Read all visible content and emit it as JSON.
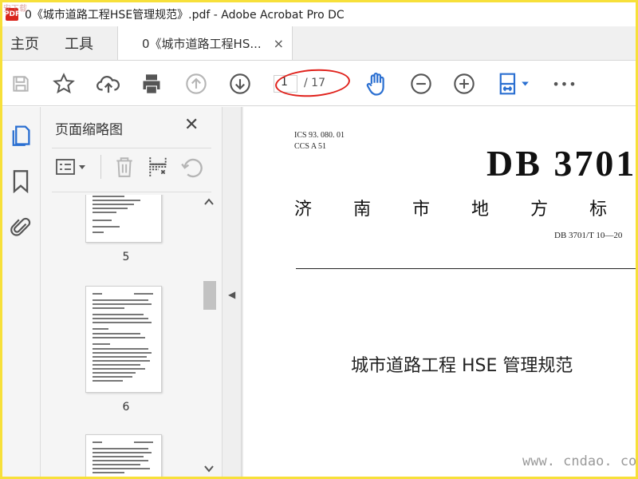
{
  "window": {
    "title": "0《城市道路工程HSE管理规范》.pdf - Adobe Acrobat Pro DC",
    "watermark_corner": "安下载",
    "app_icon_text": "PDF"
  },
  "tabs": {
    "home": "主页",
    "tools": "工具",
    "document": "0《城市道路工程HS...",
    "close": "×"
  },
  "toolbar": {
    "page_current": "1",
    "page_total": "/ 17",
    "more": "•••"
  },
  "panel": {
    "title": "页面缩略图",
    "close": "✕",
    "thumbnails": [
      {
        "label": "5"
      },
      {
        "label": "6"
      }
    ]
  },
  "document": {
    "ics": "ICS   93. 080. 01",
    "ccs": "CCS   A   51",
    "code": "DB 3701",
    "title_chars": [
      "济",
      "南",
      "市",
      "地",
      "方",
      "标"
    ],
    "number": "DB 3701/T  10—20",
    "doc_title": "城市道路工程 HSE 管理规范"
  },
  "watermark": "www. cndao. com",
  "colors": {
    "accent_blue": "#2a6fd1",
    "highlight_red": "#e0211b",
    "frame_yellow": "#f7e03a"
  }
}
